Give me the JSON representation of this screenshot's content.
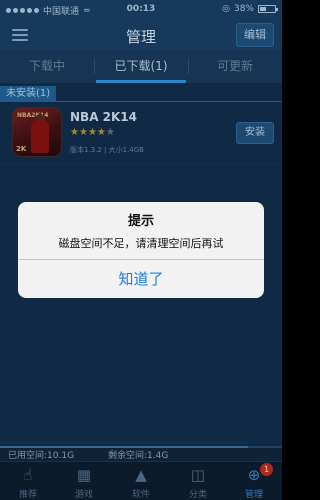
{
  "status_bar": {
    "carrier": "中国联通",
    "time": "00:13",
    "battery_percent": "38%"
  },
  "nav": {
    "title": "管理",
    "edit_label": "编辑"
  },
  "tabs": [
    {
      "label": "下载中"
    },
    {
      "label": "已下载(1)"
    },
    {
      "label": "可更新"
    }
  ],
  "section": {
    "label": "未安装(1)"
  },
  "app": {
    "name": "NBA 2K14",
    "rating": 4,
    "rating_max": 5,
    "version_size": "版本1.3.2 | 大小1.4GB",
    "install_label": "安装",
    "icon_logo_text": "NBA2K14",
    "icon_brand_text": "2K"
  },
  "storage": {
    "used": "已用空间:10.1G",
    "free": "剩余空间:1.4G"
  },
  "tab_bar": [
    {
      "label": "推荐",
      "icon": "thumbs-up-icon"
    },
    {
      "label": "游戏",
      "icon": "gamepad-icon"
    },
    {
      "label": "软件",
      "icon": "apps-icon"
    },
    {
      "label": "分类",
      "icon": "grid-icon"
    },
    {
      "label": "管理",
      "icon": "download-manage-icon",
      "badge": "1"
    }
  ],
  "alert": {
    "title": "提示",
    "message": "磁盘空间不足，请清理空间后再试",
    "button": "知道了"
  },
  "colors": {
    "accent": "#2c86c8",
    "alert_button": "#1a7ff0",
    "badge": "#b0271e"
  }
}
